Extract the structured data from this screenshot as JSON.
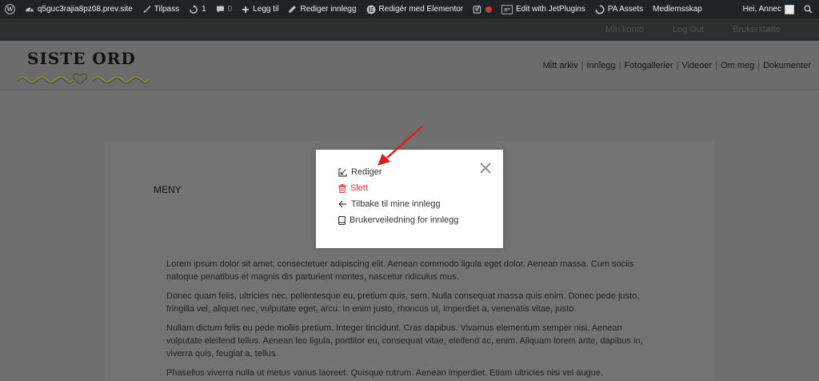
{
  "adminbar": {
    "site": "q5guc3rajia8pz08.prev.site",
    "customize": "Tilpass",
    "updates_count": "1",
    "comments_count": "0",
    "add_new": "Legg til",
    "edit_post": "Rediger innlegg",
    "elementor": "Redigér med Elementor",
    "jetplugins": "Edit with JetPlugins",
    "pa_assets": "PA Assets",
    "membership": "Medlemsskap",
    "greeting": "Hei, Annec"
  },
  "topbar": {
    "links": [
      "Min konto",
      "Log Out",
      "Brukerstøtte"
    ]
  },
  "header": {
    "logo_text": "SISTE ORD",
    "nav": [
      "Mitt arkiv",
      "Innlegg",
      "Fotogallerier",
      "Videoer",
      "Om meg",
      "Dokumenter"
    ]
  },
  "content": {
    "meny": "MENY",
    "paragraphs": [
      "Lorem ipsum dolor sit amet, consectetuer adipiscing elit. Aenean commodo ligula eget dolor. Aenean massa. Cum sociis natoque penatibus et magnis dis parturient montes, nascetur ridiculus mus.",
      "Donec quam felis, ultricies nec, pellentesque eu, pretium quis, sem. Nulla consequat massa quis enim. Donec pede justo, fringilla vel, aliquet nec, vulputate eget, arcu. In enim justo, rhoncus ut, imperdiet a, venenatis vitae, justo.",
      "Nullam dictum felis eu pede mollis pretium. Integer tincidunt. Cras dapibus. Vivamus elementum semper nisi. Aenean vulputate eleifend tellus. Aenean leo ligula, porttitor eu, consequat vitae, eleifend ac, enim. Aliquam lorem ante, dapibus in, viverra quis, feugiat a, tellus.",
      "Phasellus viverra nulla ut metus varius laoreet. Quisque rutrum. Aenean imperdiet. Etiam ultricies nisi vel augue."
    ]
  },
  "modal": {
    "edit": "Rediger",
    "delete": "Slett",
    "back": "Tilbake til mine innlegg",
    "guide": "Brukerveiledning for innlegg"
  },
  "colors": {
    "adminbar_bg": "#1d2327",
    "danger": "#e63946",
    "annotation_arrow": "#e01b1b"
  }
}
